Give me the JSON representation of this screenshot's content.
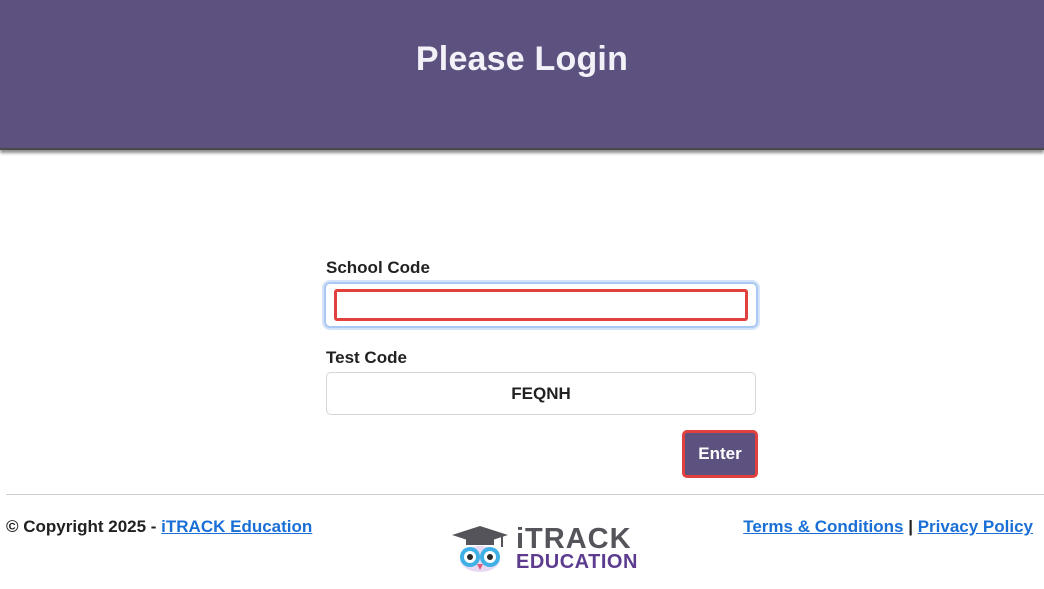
{
  "header": {
    "title": "Please Login"
  },
  "form": {
    "school_code_label": "School Code",
    "school_code_value": "",
    "test_code_label": "Test Code",
    "test_code_value": "FEQNH",
    "enter_label": "Enter"
  },
  "footer": {
    "copyright_text": "© Copyright 2025 - ",
    "company_link": "iTRACK Education",
    "terms_link": "Terms & Conditions",
    "separator": " | ",
    "privacy_link": "Privacy Policy",
    "logo_line1": "iTRACK",
    "logo_line2": "EDUCATION",
    "logo_icon": "owl-graduate-icon"
  },
  "colors": {
    "brand_purple": "#5d527f",
    "focus_red": "#e0403e",
    "link_blue": "#1a6fd6"
  }
}
